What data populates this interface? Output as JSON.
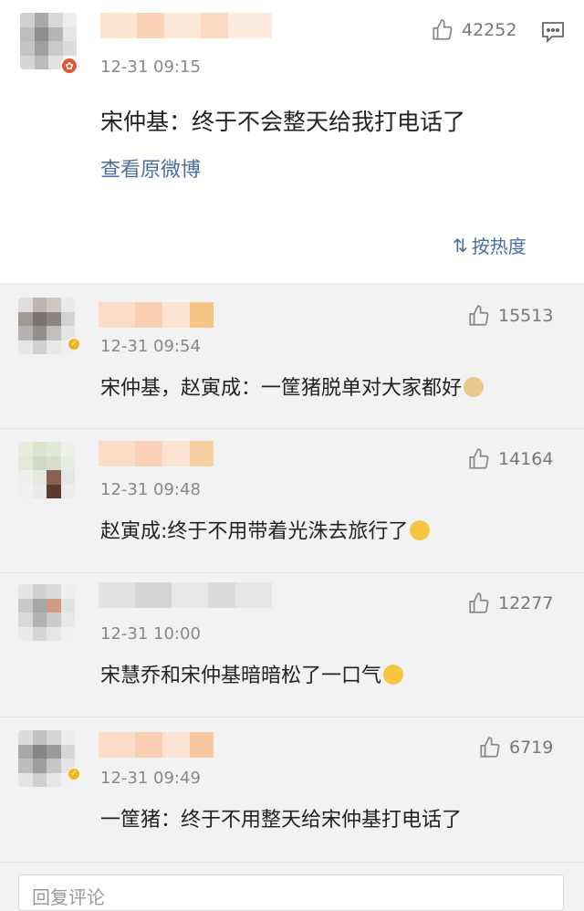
{
  "main_post": {
    "time": "12-31 09:15",
    "likes": "42252",
    "text": "宋仲基：终于不会整天给我打电话了",
    "view_original": "查看原微博",
    "sort_label": "按热度",
    "icons": {
      "like": "thumbs-up-icon",
      "comment": "comment-icon",
      "badge": "verified-red-badge-icon"
    }
  },
  "replies": [
    {
      "time": "12-31 09:54",
      "likes": "15513",
      "text": "宋仲基，赵寅成：一筐猪脱单对大家都好",
      "emoji": "doge-emoji"
    },
    {
      "time": "12-31 09:48",
      "likes": "14164",
      "text": "赵寅成:终于不用带着光洙去旅行了",
      "emoji": "laugh-cry-emoji"
    },
    {
      "time": "12-31 10:00",
      "likes": "12277",
      "text": "宋慧乔和宋仲基暗暗松了一口气",
      "emoji": "relieved-emoji"
    },
    {
      "time": "12-31 09:49",
      "likes": "6719",
      "text": "一筐猪：终于不用整天给宋仲基打电话了",
      "emoji": ""
    }
  ],
  "comment_box": {
    "placeholder": "回复评论"
  }
}
